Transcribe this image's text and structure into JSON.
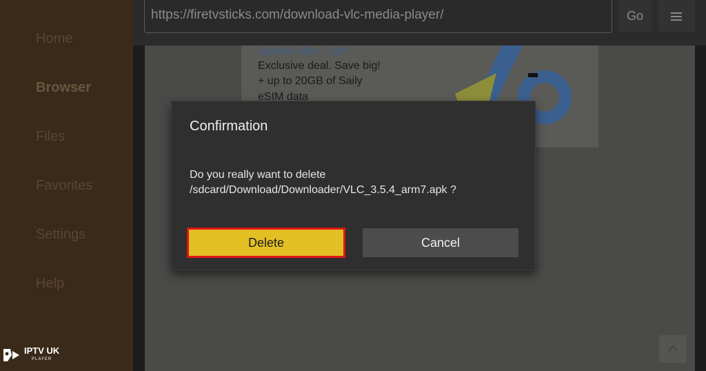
{
  "sidebar": {
    "items": [
      {
        "label": "Home"
      },
      {
        "label": "Browser"
      },
      {
        "label": "Files"
      },
      {
        "label": "Favorites"
      },
      {
        "label": "Settings"
      },
      {
        "label": "Help"
      }
    ],
    "active_item": "Browser"
  },
  "toolbar": {
    "url": "https://firetvsticks.com/download-vlc-media-player/",
    "go_label": "Go",
    "menu_icon": "hamburger-menu-icon"
  },
  "web_content": {
    "ad": {
      "line1": "Special offer + gift",
      "line2": "Exclusive deal. Save big!",
      "line3": "+ up to 20GB of Saily",
      "line4": "eSIM data"
    }
  },
  "dialog": {
    "title": "Confirmation",
    "message": "Do you really want to delete /sdcard/Download/Downloader/VLC_3.5.4_arm7.apk ?",
    "delete_label": "Delete",
    "cancel_label": "Cancel"
  },
  "watermark": {
    "brand": "IPTV UK",
    "sub": "PLAYER"
  },
  "colors": {
    "sidebar_bg": "#3a2a1a",
    "dialog_bg": "#2e2f2e",
    "delete_button": "#e2c024",
    "focus_border": "#e01616",
    "cancel_button": "#4c4c4c"
  }
}
